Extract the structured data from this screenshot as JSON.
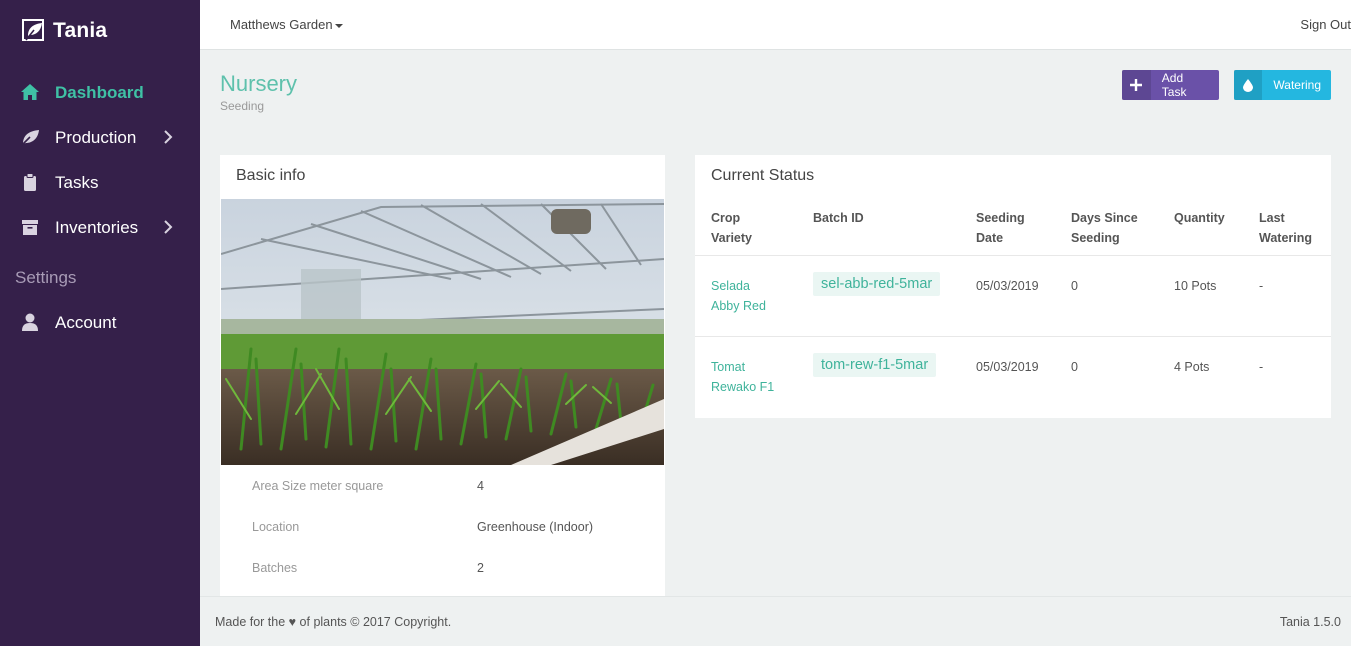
{
  "brand": {
    "name": "Tania"
  },
  "sidebar": {
    "items": [
      {
        "label": "Dashboard",
        "icon": "home-icon"
      },
      {
        "label": "Production",
        "icon": "leaf-icon"
      },
      {
        "label": "Tasks",
        "icon": "clipboard-icon"
      },
      {
        "label": "Inventories",
        "icon": "archive-icon"
      }
    ],
    "settings_header": "Settings",
    "account": {
      "label": "Account",
      "icon": "user-icon"
    }
  },
  "topbar": {
    "farm": "Matthews Garden",
    "signout": "Sign Out"
  },
  "page": {
    "title": "Nursery",
    "subtitle": "Seeding"
  },
  "actions": {
    "add_task": "Add Task",
    "watering": "Watering"
  },
  "basic_info": {
    "title": "Basic info",
    "rows": [
      {
        "label": "Area Size meter square",
        "value": "4"
      },
      {
        "label": "Location",
        "value": "Greenhouse (Indoor)"
      },
      {
        "label": "Batches",
        "value": "2"
      }
    ]
  },
  "current_status": {
    "title": "Current Status",
    "headers": {
      "crop_1": "Crop",
      "crop_2": "Variety",
      "batch": "Batch ID",
      "seeding_1": "Seeding",
      "seeding_2": "Date",
      "days_1": "Days Since",
      "days_2": "Seeding",
      "quantity": "Quantity",
      "watering_1": "Last",
      "watering_2": "Watering"
    },
    "rows": [
      {
        "crop": "Selada",
        "variety": "Abby Red",
        "batch_id": "sel-abb-red-5mar",
        "seeding_date": "05/03/2019",
        "days": "0",
        "quantity": "10 Pots",
        "last_watering": "-"
      },
      {
        "crop": "Tomat",
        "variety": "Rewako F1",
        "batch_id": "tom-rew-f1-5mar",
        "seeding_date": "05/03/2019",
        "days": "0",
        "quantity": "4 Pots",
        "last_watering": "-"
      }
    ]
  },
  "footer": {
    "left": "Made for the ♥ of plants © 2017 Copyright.",
    "right": "Tania 1.5.0"
  },
  "colors": {
    "sidebar_bg": "#35204a",
    "accent": "#3fc1a5",
    "add_task_bg": "#6a51a8",
    "watering_bg": "#24b7e0"
  }
}
